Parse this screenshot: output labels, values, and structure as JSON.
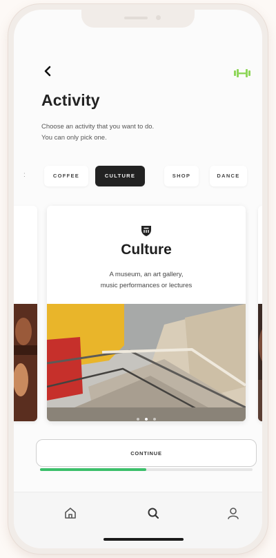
{
  "header": {
    "back_icon": "chevron-left-icon",
    "logo_icon": "dumbbell-icon",
    "logo_color": "#8fd65a",
    "title": "Activity",
    "subtitle_line1": "Choose an activity that you want to do.",
    "subtitle_line2": "You can only pick one."
  },
  "categories": {
    "items": [
      {
        "label": "COFFEE",
        "selected": false
      },
      {
        "label": "CULTURE",
        "selected": true
      },
      {
        "label": "SHOP",
        "selected": false
      },
      {
        "label": "DANCE",
        "selected": false
      }
    ]
  },
  "card": {
    "icon": "museum-icon",
    "title": "Culture",
    "desc_line1": "A museum, an art gallery,",
    "desc_line2": "music performances or lectures",
    "carousel_page": 2,
    "carousel_total": 3
  },
  "actions": {
    "continue_label": "CONTINUE",
    "progress": 0.5,
    "progress_color": "#3bbf6a"
  },
  "tabbar": {
    "items": [
      {
        "icon": "home-icon"
      },
      {
        "icon": "search-icon"
      },
      {
        "icon": "profile-icon"
      }
    ]
  }
}
